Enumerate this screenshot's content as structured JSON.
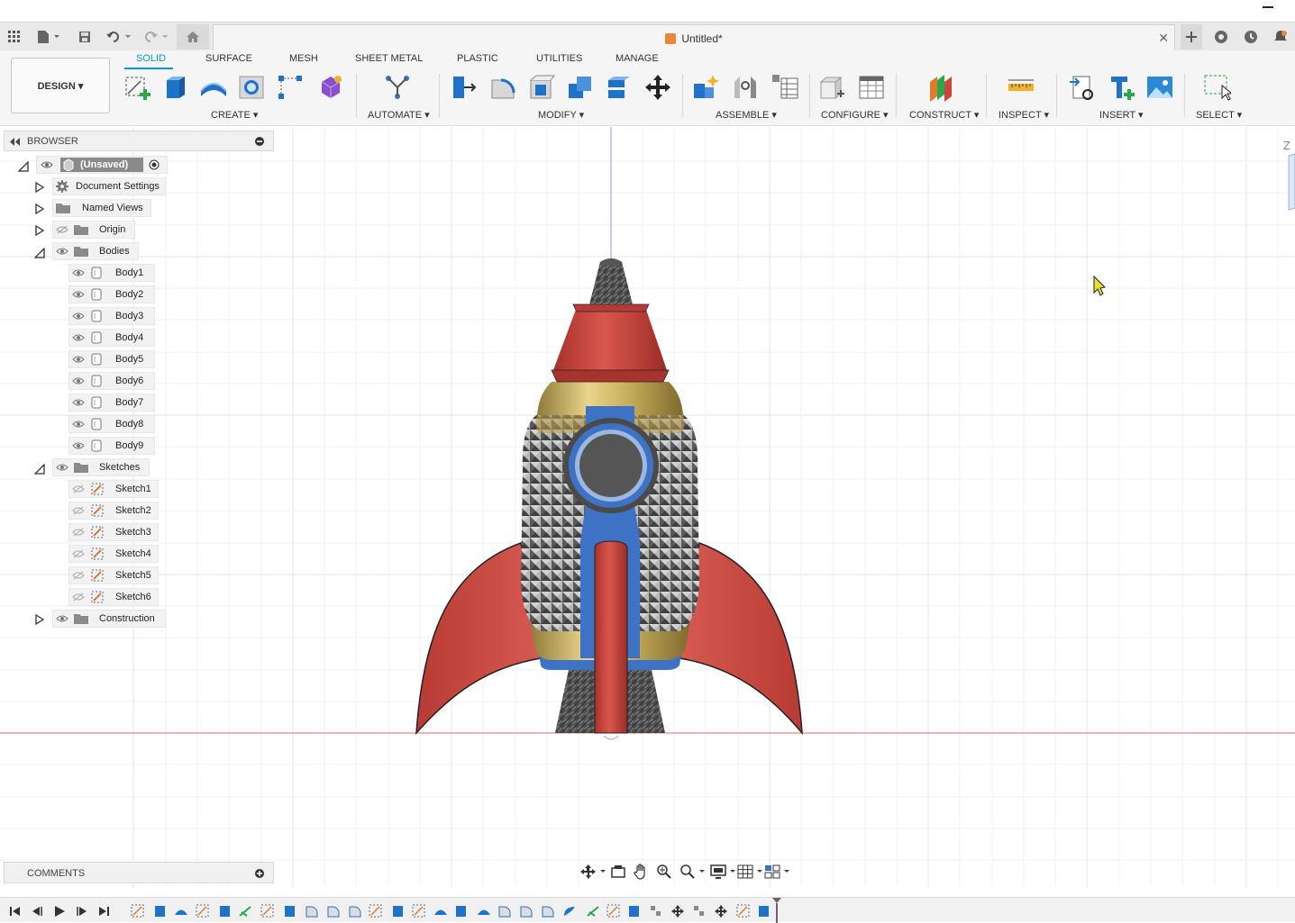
{
  "titlebar": {
    "minimize_label": "–"
  },
  "document": {
    "title": "Untitled*",
    "close_glyph": "✕"
  },
  "workspace": {
    "label": "DESIGN ▾"
  },
  "tabs": [
    {
      "label": "SOLID",
      "active": true
    },
    {
      "label": "SURFACE"
    },
    {
      "label": "MESH"
    },
    {
      "label": "SHEET METAL"
    },
    {
      "label": "PLASTIC"
    },
    {
      "label": "UTILITIES"
    },
    {
      "label": "MANAGE"
    }
  ],
  "groups": {
    "create": "CREATE ▾",
    "automate": "AUTOMATE ▾",
    "modify": "MODIFY ▾",
    "assemble": "ASSEMBLE ▾",
    "configure": "CONFIGURE ▾",
    "construct": "CONSTRUCT ▾",
    "inspect": "INSPECT ▾",
    "insert": "INSERT ▾",
    "select": "SELECT ▾"
  },
  "browser": {
    "title": "BROWSER",
    "root": "(Unsaved)",
    "folders": {
      "document_settings": "Document Settings",
      "named_views": "Named Views",
      "origin": "Origin",
      "bodies": "Bodies",
      "sketches": "Sketches",
      "construction": "Construction"
    },
    "bodies": [
      "Body1",
      "Body2",
      "Body3",
      "Body4",
      "Body5",
      "Body6",
      "Body7",
      "Body8",
      "Body9"
    ],
    "sketches": [
      "Sketch1",
      "Sketch2",
      "Sketch3",
      "Sketch4",
      "Sketch5",
      "Sketch6"
    ]
  },
  "comments": {
    "title": "COMMENTS"
  },
  "viewcube": {
    "axis_label": "Z"
  },
  "colors": {
    "accent": "#0696d7",
    "fin_red": "#c9463f",
    "gold": "#c9b25e",
    "blue": "#3d72c4",
    "x_axis": "#e06a6a"
  }
}
